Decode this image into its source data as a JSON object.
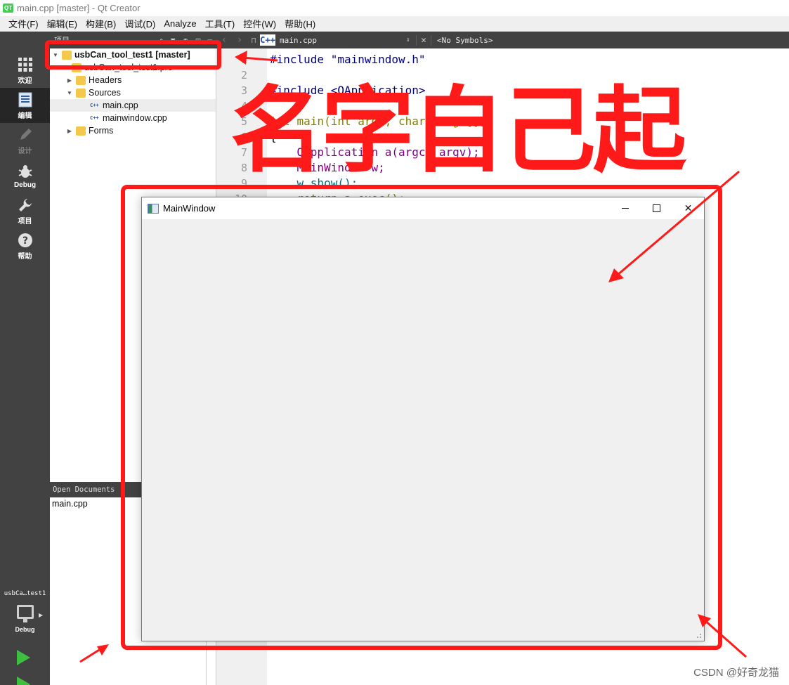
{
  "window": {
    "title": "main.cpp [master] - Qt Creator",
    "logo_text": "QT"
  },
  "menubar": {
    "items": [
      "文件(F)",
      "编辑(E)",
      "构建(B)",
      "调试(D)",
      "Analyze",
      "工具(T)",
      "控件(W)",
      "帮助(H)"
    ]
  },
  "modebar": {
    "items": [
      {
        "label": "欢迎",
        "icon": "grid-icon"
      },
      {
        "label": "编辑",
        "icon": "document-icon"
      },
      {
        "label": "设计",
        "icon": "pencil-icon"
      },
      {
        "label": "Debug",
        "icon": "bug-icon"
      },
      {
        "label": "项目",
        "icon": "wrench-icon"
      },
      {
        "label": "帮助",
        "icon": "help-icon"
      }
    ],
    "kit_name": "usbCa…test1",
    "kit_mode": "Debug"
  },
  "project": {
    "header": "项目",
    "tree": [
      {
        "label": "usbCan_tool_test1 [master]",
        "depth": 0,
        "type": "project"
      },
      {
        "label": "usbCan_tool_test1.pro",
        "depth": 1,
        "type": "pro"
      },
      {
        "label": "Headers",
        "depth": 1,
        "type": "folder"
      },
      {
        "label": "Sources",
        "depth": 1,
        "type": "folder"
      },
      {
        "label": "main.cpp",
        "depth": 2,
        "type": "cpp"
      },
      {
        "label": "mainwindow.cpp",
        "depth": 2,
        "type": "cpp"
      },
      {
        "label": "Forms",
        "depth": 1,
        "type": "folder"
      }
    ]
  },
  "open_documents": {
    "header": "Open Documents",
    "items": [
      "main.cpp"
    ]
  },
  "editor_bar": {
    "file_badge": "C++",
    "file": "main.cpp",
    "symbols": "<No Symbols>"
  },
  "editor": {
    "line_numbers": [
      "1",
      "2",
      "3",
      "4",
      "5",
      "6",
      "7",
      "8",
      "9",
      "10"
    ],
    "lines": [
      "#include \"mainwindow.h\"",
      "",
      "#include <QApplication>",
      "",
      "int main(int argc, char *argv[])",
      "{",
      "    QApplication a(argc, argv);",
      "    MainWindow w;",
      "    w.show();",
      "    return a.exec();"
    ]
  },
  "mainwindow": {
    "title": "MainWindow",
    "close_glyph": "✕"
  },
  "annotation": {
    "text": "名字自己起",
    "color": "#ff1a1a"
  },
  "watermark": "CSDN @好奇龙猫"
}
